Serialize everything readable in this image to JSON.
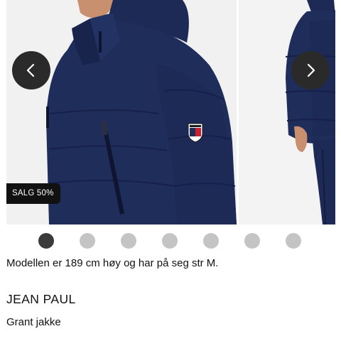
{
  "gallery": {
    "sale_badge": "SALG 50%",
    "active_index": 0,
    "dot_count": 7,
    "prev_icon": "chevron-left-icon",
    "next_icon": "chevron-right-icon",
    "colors": {
      "jacket": "#1f2d5a",
      "jacket_shade": "#17224a",
      "background": "#f1f1f1",
      "dot_active": "#3a3a3a",
      "dot_inactive": "#c4c4c4"
    }
  },
  "product": {
    "model_note": "Modellen er 189 cm høy og har på seg str M.",
    "brand": "JEAN PAUL",
    "name": "Grant jakke"
  }
}
